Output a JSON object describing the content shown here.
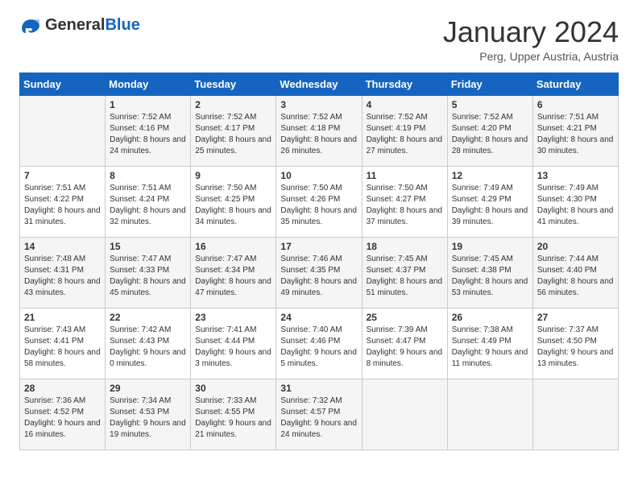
{
  "header": {
    "logo_general": "General",
    "logo_blue": "Blue",
    "month": "January 2024",
    "location": "Perg, Upper Austria, Austria"
  },
  "weekdays": [
    "Sunday",
    "Monday",
    "Tuesday",
    "Wednesday",
    "Thursday",
    "Friday",
    "Saturday"
  ],
  "weeks": [
    [
      {
        "day": "",
        "sunrise": "",
        "sunset": "",
        "daylight": ""
      },
      {
        "day": "1",
        "sunrise": "Sunrise: 7:52 AM",
        "sunset": "Sunset: 4:16 PM",
        "daylight": "Daylight: 8 hours and 24 minutes."
      },
      {
        "day": "2",
        "sunrise": "Sunrise: 7:52 AM",
        "sunset": "Sunset: 4:17 PM",
        "daylight": "Daylight: 8 hours and 25 minutes."
      },
      {
        "day": "3",
        "sunrise": "Sunrise: 7:52 AM",
        "sunset": "Sunset: 4:18 PM",
        "daylight": "Daylight: 8 hours and 26 minutes."
      },
      {
        "day": "4",
        "sunrise": "Sunrise: 7:52 AM",
        "sunset": "Sunset: 4:19 PM",
        "daylight": "Daylight: 8 hours and 27 minutes."
      },
      {
        "day": "5",
        "sunrise": "Sunrise: 7:52 AM",
        "sunset": "Sunset: 4:20 PM",
        "daylight": "Daylight: 8 hours and 28 minutes."
      },
      {
        "day": "6",
        "sunrise": "Sunrise: 7:51 AM",
        "sunset": "Sunset: 4:21 PM",
        "daylight": "Daylight: 8 hours and 30 minutes."
      }
    ],
    [
      {
        "day": "7",
        "sunrise": "Sunrise: 7:51 AM",
        "sunset": "Sunset: 4:22 PM",
        "daylight": "Daylight: 8 hours and 31 minutes."
      },
      {
        "day": "8",
        "sunrise": "Sunrise: 7:51 AM",
        "sunset": "Sunset: 4:24 PM",
        "daylight": "Daylight: 8 hours and 32 minutes."
      },
      {
        "day": "9",
        "sunrise": "Sunrise: 7:50 AM",
        "sunset": "Sunset: 4:25 PM",
        "daylight": "Daylight: 8 hours and 34 minutes."
      },
      {
        "day": "10",
        "sunrise": "Sunrise: 7:50 AM",
        "sunset": "Sunset: 4:26 PM",
        "daylight": "Daylight: 8 hours and 35 minutes."
      },
      {
        "day": "11",
        "sunrise": "Sunrise: 7:50 AM",
        "sunset": "Sunset: 4:27 PM",
        "daylight": "Daylight: 8 hours and 37 minutes."
      },
      {
        "day": "12",
        "sunrise": "Sunrise: 7:49 AM",
        "sunset": "Sunset: 4:29 PM",
        "daylight": "Daylight: 8 hours and 39 minutes."
      },
      {
        "day": "13",
        "sunrise": "Sunrise: 7:49 AM",
        "sunset": "Sunset: 4:30 PM",
        "daylight": "Daylight: 8 hours and 41 minutes."
      }
    ],
    [
      {
        "day": "14",
        "sunrise": "Sunrise: 7:48 AM",
        "sunset": "Sunset: 4:31 PM",
        "daylight": "Daylight: 8 hours and 43 minutes."
      },
      {
        "day": "15",
        "sunrise": "Sunrise: 7:47 AM",
        "sunset": "Sunset: 4:33 PM",
        "daylight": "Daylight: 8 hours and 45 minutes."
      },
      {
        "day": "16",
        "sunrise": "Sunrise: 7:47 AM",
        "sunset": "Sunset: 4:34 PM",
        "daylight": "Daylight: 8 hours and 47 minutes."
      },
      {
        "day": "17",
        "sunrise": "Sunrise: 7:46 AM",
        "sunset": "Sunset: 4:35 PM",
        "daylight": "Daylight: 8 hours and 49 minutes."
      },
      {
        "day": "18",
        "sunrise": "Sunrise: 7:45 AM",
        "sunset": "Sunset: 4:37 PM",
        "daylight": "Daylight: 8 hours and 51 minutes."
      },
      {
        "day": "19",
        "sunrise": "Sunrise: 7:45 AM",
        "sunset": "Sunset: 4:38 PM",
        "daylight": "Daylight: 8 hours and 53 minutes."
      },
      {
        "day": "20",
        "sunrise": "Sunrise: 7:44 AM",
        "sunset": "Sunset: 4:40 PM",
        "daylight": "Daylight: 8 hours and 56 minutes."
      }
    ],
    [
      {
        "day": "21",
        "sunrise": "Sunrise: 7:43 AM",
        "sunset": "Sunset: 4:41 PM",
        "daylight": "Daylight: 8 hours and 58 minutes."
      },
      {
        "day": "22",
        "sunrise": "Sunrise: 7:42 AM",
        "sunset": "Sunset: 4:43 PM",
        "daylight": "Daylight: 9 hours and 0 minutes."
      },
      {
        "day": "23",
        "sunrise": "Sunrise: 7:41 AM",
        "sunset": "Sunset: 4:44 PM",
        "daylight": "Daylight: 9 hours and 3 minutes."
      },
      {
        "day": "24",
        "sunrise": "Sunrise: 7:40 AM",
        "sunset": "Sunset: 4:46 PM",
        "daylight": "Daylight: 9 hours and 5 minutes."
      },
      {
        "day": "25",
        "sunrise": "Sunrise: 7:39 AM",
        "sunset": "Sunset: 4:47 PM",
        "daylight": "Daylight: 9 hours and 8 minutes."
      },
      {
        "day": "26",
        "sunrise": "Sunrise: 7:38 AM",
        "sunset": "Sunset: 4:49 PM",
        "daylight": "Daylight: 9 hours and 11 minutes."
      },
      {
        "day": "27",
        "sunrise": "Sunrise: 7:37 AM",
        "sunset": "Sunset: 4:50 PM",
        "daylight": "Daylight: 9 hours and 13 minutes."
      }
    ],
    [
      {
        "day": "28",
        "sunrise": "Sunrise: 7:36 AM",
        "sunset": "Sunset: 4:52 PM",
        "daylight": "Daylight: 9 hours and 16 minutes."
      },
      {
        "day": "29",
        "sunrise": "Sunrise: 7:34 AM",
        "sunset": "Sunset: 4:53 PM",
        "daylight": "Daylight: 9 hours and 19 minutes."
      },
      {
        "day": "30",
        "sunrise": "Sunrise: 7:33 AM",
        "sunset": "Sunset: 4:55 PM",
        "daylight": "Daylight: 9 hours and 21 minutes."
      },
      {
        "day": "31",
        "sunrise": "Sunrise: 7:32 AM",
        "sunset": "Sunset: 4:57 PM",
        "daylight": "Daylight: 9 hours and 24 minutes."
      },
      {
        "day": "",
        "sunrise": "",
        "sunset": "",
        "daylight": ""
      },
      {
        "day": "",
        "sunrise": "",
        "sunset": "",
        "daylight": ""
      },
      {
        "day": "",
        "sunrise": "",
        "sunset": "",
        "daylight": ""
      }
    ]
  ]
}
